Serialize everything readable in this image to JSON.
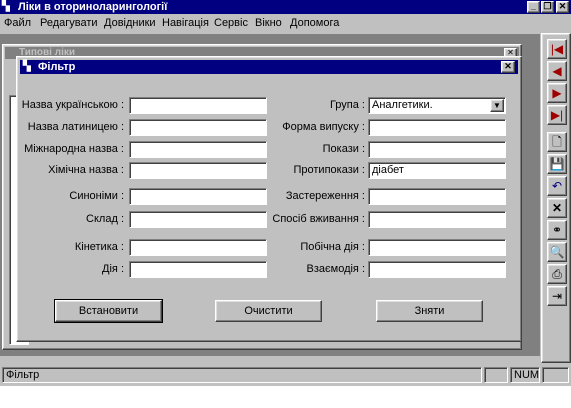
{
  "window": {
    "title": "Ліки в оториноларингології"
  },
  "menu": [
    {
      "label": "Файл"
    },
    {
      "label": "Редагувати"
    },
    {
      "label": "Довідники"
    },
    {
      "label": "Навігація"
    },
    {
      "label": "Сервіс"
    },
    {
      "label": "Вікно"
    },
    {
      "label": "Допомога"
    }
  ],
  "child": {
    "title": "Типові ліки"
  },
  "dialog": {
    "title": "Фільтр",
    "left_fields": [
      {
        "label": "Назва українською :",
        "value": ""
      },
      {
        "label": "Назва латиницею :",
        "value": ""
      },
      {
        "label": "Міжнародна назва :",
        "value": ""
      },
      {
        "label": "Хімічна назва :",
        "value": ""
      },
      {
        "label": "Синоніми :",
        "value": ""
      },
      {
        "label": "Склад :",
        "value": ""
      },
      {
        "label": "Кінетика :",
        "value": ""
      },
      {
        "label": "Дія :",
        "value": ""
      }
    ],
    "right_fields": [
      {
        "label": "Група :",
        "value": "Аналгетики."
      },
      {
        "label": "Форма випуску :",
        "value": ""
      },
      {
        "label": "Покази :",
        "value": ""
      },
      {
        "label": "Протипокази :",
        "value": "діабет"
      },
      {
        "label": "Застереження :",
        "value": ""
      },
      {
        "label": "Спосіб вживання :",
        "value": ""
      },
      {
        "label": "Побічна дія :",
        "value": ""
      },
      {
        "label": "Взаємодія :",
        "value": ""
      }
    ],
    "buttons": {
      "set": "Встановити",
      "clear": "Очистити",
      "remove": "Зняти"
    }
  },
  "status": {
    "message": "Фільтр",
    "num": "NUM"
  },
  "icons": [
    "first-record-icon",
    "prev-record-icon",
    "next-record-icon",
    "last-record-icon",
    "new-document-icon",
    "save-icon",
    "undo-icon",
    "delete-icon",
    "binoculars-icon",
    "zoom-icon",
    "print-icon",
    "export-icon"
  ]
}
